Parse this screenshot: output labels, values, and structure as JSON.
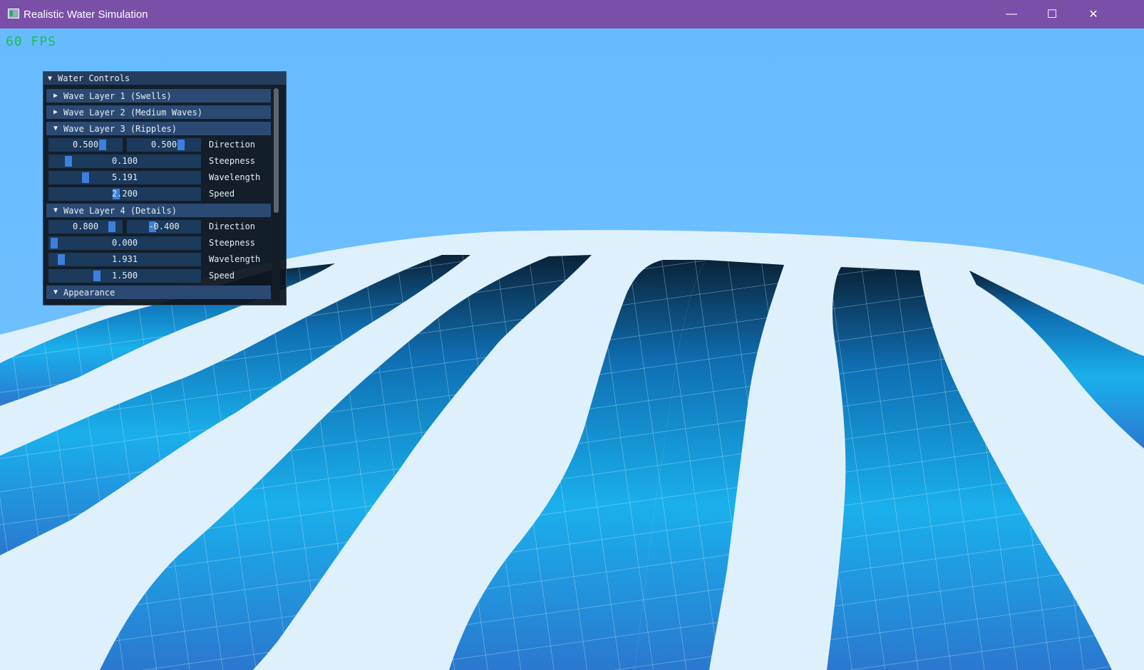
{
  "window": {
    "title": "Realistic Water Simulation",
    "minimize_glyph": "—",
    "maximize_glyph": "☐",
    "close_glyph": "✕"
  },
  "overlay": {
    "fps": "60 FPS"
  },
  "panel": {
    "title": "Water Controls",
    "sections": [
      {
        "label": "Wave Layer 1 (Swells)",
        "expanded": false
      },
      {
        "label": "Wave Layer 2 (Medium Waves)",
        "expanded": false
      },
      {
        "label": "Wave Layer 3 (Ripples)",
        "expanded": true,
        "direction": [
          "0.500",
          "0.500"
        ],
        "direction_label": "Direction",
        "steepness": "0.100",
        "steepness_label": "Steepness",
        "wavelength": "5.191",
        "wavelength_label": "Wavelength",
        "speed": "2.200",
        "speed_label": "Speed"
      },
      {
        "label": "Wave Layer 4 (Details)",
        "expanded": true,
        "direction": [
          "0.800",
          "-0.400"
        ],
        "direction_label": "Direction",
        "steepness": "0.000",
        "steepness_label": "Steepness",
        "wavelength": "1.931",
        "wavelength_label": "Wavelength",
        "speed": "1.500",
        "speed_label": "Speed"
      },
      {
        "label": "Appearance",
        "expanded": true
      }
    ]
  },
  "colors": {
    "titlebar": "#7a4fa8",
    "sky": "#66bbff",
    "fps_text": "#19c04a",
    "slider_grab": "#3d7fdc",
    "header": "#2b4a73"
  }
}
